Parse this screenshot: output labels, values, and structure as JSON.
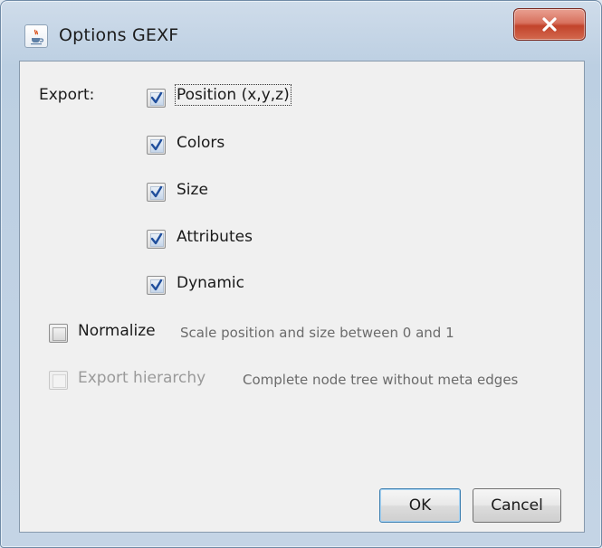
{
  "window": {
    "title": "Options GEXF",
    "icon": "java-cup-icon",
    "close_icon": "close-icon"
  },
  "export_section": {
    "label": "Export:",
    "options": [
      {
        "label": "Position (x,y,z)",
        "checked": true,
        "focused": true
      },
      {
        "label": "Colors",
        "checked": true
      },
      {
        "label": "Size",
        "checked": true
      },
      {
        "label": "Attributes",
        "checked": true
      },
      {
        "label": "Dynamic",
        "checked": true
      }
    ]
  },
  "normalize": {
    "label": "Normalize",
    "checked": false,
    "hint": "Scale position and size between 0 and 1"
  },
  "export_hierarchy": {
    "label": "Export hierarchy",
    "checked": false,
    "enabled": false,
    "hint": "Complete node tree without meta edges"
  },
  "buttons": {
    "ok": "OK",
    "cancel": "Cancel"
  },
  "colors": {
    "close_button": "#c2432b",
    "default_button_border": "#3c7fb1",
    "checkmark": "#1f4e9c"
  }
}
